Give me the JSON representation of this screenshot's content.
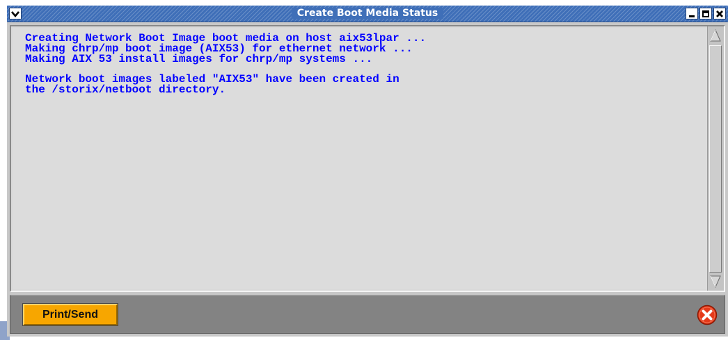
{
  "window": {
    "title": "Create Boot Media Status",
    "menu_icon": "chevron-down-icon",
    "minimize_icon": "minimize-icon",
    "maximize_icon": "maximize-icon",
    "close_icon": "close-icon"
  },
  "log": {
    "lines": [
      "Creating Network Boot Image boot media on host aix53lpar ...",
      "Making chrp/mp boot image (AIX53) for ethernet network ...",
      "Making AIX 53 install images for chrp/mp systems ...",
      "",
      "Network boot images labeled \"AIX53\" have been created in",
      "the /storix/netboot directory."
    ],
    "text_color": "#0000ff"
  },
  "scrollbar": {
    "up_icon": "scroll-up-arrow-icon",
    "down_icon": "scroll-down-arrow-icon"
  },
  "footer": {
    "print_send_label": "Print/Send",
    "close_button_icon": "close-circle-icon",
    "button_color": "#f7a600",
    "close_color": "#e53a1a"
  }
}
